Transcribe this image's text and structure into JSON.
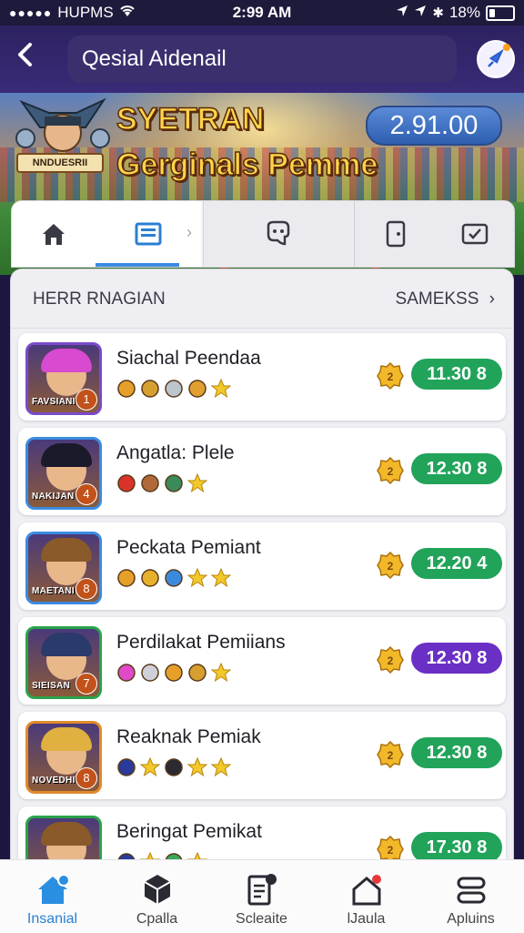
{
  "status_bar": {
    "carrier": "HUPMS",
    "time": "2:99 AM",
    "battery": "18%"
  },
  "header": {
    "title": "Qesial Aidenail"
  },
  "hero": {
    "avatar_label": "NNDUESRII",
    "title_line1": "SYETRAN",
    "title_line2": "Gerginals Pemme",
    "score": "2.91.00"
  },
  "tabs": [
    {
      "icon": "home-icon",
      "active": false
    },
    {
      "icon": "news-icon",
      "active": true
    },
    {
      "icon": "social-icon",
      "active": false
    },
    {
      "icon": "phone-icon",
      "active": false
    },
    {
      "icon": "check-icon",
      "active": false
    }
  ],
  "section": {
    "left_label": "HERR RNAGIAN",
    "right_label": "SAMEKSS",
    "right_chevron": "›"
  },
  "rows": [
    {
      "name": "Siachal Peendaa",
      "avatar_label": "FAVSIANI",
      "avatar_num": "1",
      "score": "11.30 8",
      "score_color": "#21a35a",
      "hair": "#d84ad0",
      "border": "#7a4acb"
    },
    {
      "name": "Angatla: Plele",
      "avatar_label": "NAKIJAN",
      "avatar_num": "4",
      "score": "12.30 8",
      "score_color": "#21a35a",
      "hair": "#1a1a2a",
      "border": "#3a8be0"
    },
    {
      "name": "Peckata Pemiant",
      "avatar_label": "MAETANI",
      "avatar_num": "8",
      "score": "12.20 4",
      "score_color": "#21a35a",
      "hair": "#8a5a2a",
      "border": "#3a8be0"
    },
    {
      "name": "Perdilakat Pemiians",
      "avatar_label": "SIEISAN",
      "avatar_num": "7",
      "score": "12.30 8",
      "score_color": "#6a2fc4",
      "hair": "#2a3a6a",
      "border": "#2aa24a"
    },
    {
      "name": "Reaknak Pemiak",
      "avatar_label": "NOVEDHI",
      "avatar_num": "8",
      "score": "12.30 8",
      "score_color": "#21a35a",
      "hair": "#e0b040",
      "border": "#e08a2a"
    },
    {
      "name": "Beringat Pemikat",
      "avatar_label": "",
      "avatar_num": "",
      "score": "17.30 8",
      "score_color": "#21a35a",
      "hair": "#8a5a2a",
      "border": "#2aa24a"
    }
  ],
  "bottom_nav": [
    {
      "label": "Insanial",
      "icon": "home-icon",
      "active": true
    },
    {
      "label": "Cpalla",
      "icon": "box-icon",
      "active": false
    },
    {
      "label": "Scleaite",
      "icon": "clipboard-icon",
      "active": false
    },
    {
      "label": "lJaula",
      "icon": "house-alert-icon",
      "active": false
    },
    {
      "label": "Apluins",
      "icon": "menu-icon",
      "active": false
    }
  ]
}
